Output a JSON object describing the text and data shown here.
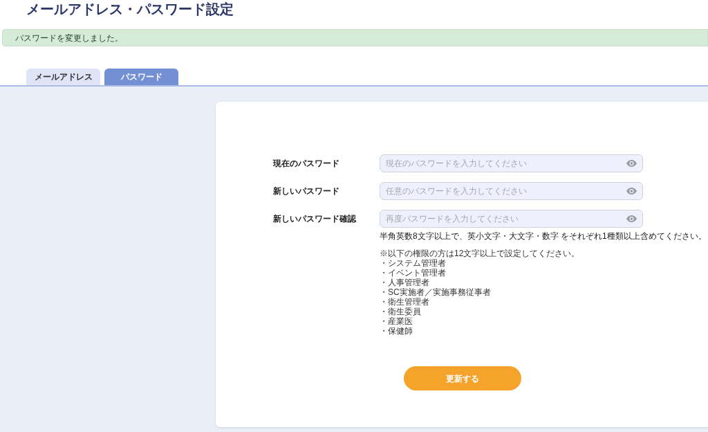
{
  "page_title": "メールアドレス・パスワード設定",
  "alert": "パスワードを変更しました。",
  "tabs": [
    {
      "label": "メールアドレス",
      "selected": false
    },
    {
      "label": "パスワード",
      "selected": true
    }
  ],
  "fields": [
    {
      "label": "現在のパスワード",
      "placeholder": "現在のパスワードを入力してください"
    },
    {
      "label": "新しいパスワード",
      "placeholder": "任意のパスワードを入力してください"
    },
    {
      "label": "新しいパスワード確認",
      "placeholder": "再度パスワードを入力してください"
    }
  ],
  "hint": "半角英数8文字以上で、英小文字・大文字・数字 をそれぞれ1種類以上含めてください。",
  "note": "※以下の権限の方は12文字以上で設定してください。",
  "roles": [
    "・システム管理者",
    "・イベント管理者",
    "・人事管理者",
    "・SC実施者／実施事務従事者",
    "・衛生管理者",
    "・衛生委員",
    "・産業医",
    "・保健師"
  ],
  "submit": "更新する"
}
